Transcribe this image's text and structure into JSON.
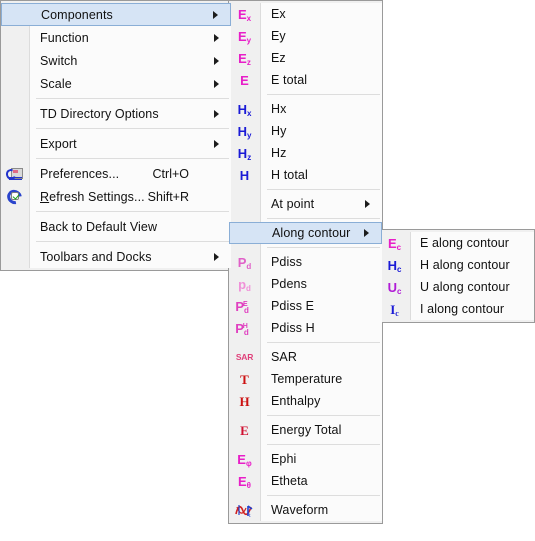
{
  "window": {
    "background": "#ffffff",
    "menu_bg": "#fbfbfb",
    "gutter_bg": "#f0f0f0",
    "border": "#9a9a9a",
    "highlight_bg": "#d6e4f5",
    "highlight_border": "#8aaed6",
    "separator": "#dddddd"
  },
  "menu1": {
    "name": "view-menu",
    "items": [
      {
        "type": "item",
        "label": "Components",
        "icon": "",
        "shortcut": "",
        "submenu": true,
        "selected": true
      },
      {
        "type": "item",
        "label": "Function",
        "icon": "",
        "shortcut": "",
        "submenu": true,
        "selected": false
      },
      {
        "type": "item",
        "label": "Switch",
        "icon": "",
        "shortcut": "",
        "submenu": true,
        "selected": false
      },
      {
        "type": "item",
        "label": "Scale",
        "icon": "",
        "shortcut": "",
        "submenu": true,
        "selected": false
      },
      {
        "type": "separator"
      },
      {
        "type": "item",
        "label": "TD Directory Options",
        "icon": "",
        "shortcut": "",
        "submenu": true,
        "selected": false
      },
      {
        "type": "separator"
      },
      {
        "type": "item",
        "label": "Export",
        "icon": "",
        "shortcut": "",
        "submenu": true,
        "selected": false
      },
      {
        "type": "separator"
      },
      {
        "type": "item",
        "label": "Preferences...",
        "icon": "preferences-icon",
        "shortcut": "Ctrl+O",
        "submenu": false,
        "selected": false
      },
      {
        "type": "item",
        "label": "Refresh Settings...",
        "icon": "refresh-icon",
        "shortcut": "Shift+R",
        "submenu": false,
        "selected": false,
        "mnemonic": "R"
      },
      {
        "type": "separator"
      },
      {
        "type": "item",
        "label": "Back to Default View",
        "icon": "",
        "shortcut": "",
        "submenu": false,
        "selected": false
      },
      {
        "type": "separator"
      },
      {
        "type": "item",
        "label": "Toolbars and Docks",
        "icon": "",
        "shortcut": "",
        "submenu": true,
        "selected": false
      }
    ]
  },
  "menu2": {
    "name": "components-submenu",
    "items": [
      {
        "type": "item",
        "label": "Ex",
        "icon": "ex-icon",
        "icon_text": "E",
        "icon_sub": "x",
        "icon_color": "#e81ec8",
        "submenu": false,
        "selected": false
      },
      {
        "type": "item",
        "label": "Ey",
        "icon": "ey-icon",
        "icon_text": "E",
        "icon_sub": "y",
        "icon_color": "#e81ec8",
        "submenu": false,
        "selected": false
      },
      {
        "type": "item",
        "label": "Ez",
        "icon": "ez-icon",
        "icon_text": "E",
        "icon_sub": "z",
        "icon_color": "#e81ec8",
        "submenu": false,
        "selected": false
      },
      {
        "type": "item",
        "label": "E total",
        "icon": "e-total-icon",
        "icon_text": "E",
        "icon_sub": "",
        "icon_color": "#e81ec8",
        "submenu": false,
        "selected": false
      },
      {
        "type": "separator"
      },
      {
        "type": "item",
        "label": "Hx",
        "icon": "hx-icon",
        "icon_text": "H",
        "icon_sub": "x",
        "icon_color": "#1a1ad6",
        "submenu": false,
        "selected": false
      },
      {
        "type": "item",
        "label": "Hy",
        "icon": "hy-icon",
        "icon_text": "H",
        "icon_sub": "y",
        "icon_color": "#1a1ad6",
        "submenu": false,
        "selected": false
      },
      {
        "type": "item",
        "label": "Hz",
        "icon": "hz-icon",
        "icon_text": "H",
        "icon_sub": "z",
        "icon_color": "#1a1ad6",
        "submenu": false,
        "selected": false
      },
      {
        "type": "item",
        "label": "H total",
        "icon": "h-total-icon",
        "icon_text": "H",
        "icon_sub": "",
        "icon_color": "#1a1ad6",
        "submenu": false,
        "selected": false
      },
      {
        "type": "separator"
      },
      {
        "type": "item",
        "label": "At point",
        "icon": "",
        "submenu": true,
        "selected": false
      },
      {
        "type": "separator"
      },
      {
        "type": "item",
        "label": "Along contour",
        "icon": "",
        "submenu": true,
        "selected": true
      },
      {
        "type": "separator"
      },
      {
        "type": "item",
        "label": "Pdiss",
        "icon": "pdiss-icon",
        "icon_text": "P",
        "icon_sub": "d",
        "icon_color": "#e060c8",
        "submenu": false,
        "selected": false
      },
      {
        "type": "item",
        "label": "Pdens",
        "icon": "pdens-icon",
        "icon_text": "p",
        "icon_sub": "d",
        "icon_color": "#f090d8",
        "submenu": false,
        "selected": false
      },
      {
        "type": "item",
        "label": "Pdiss E",
        "icon": "pdiss-e-icon",
        "icon_text": "P",
        "icon_sub": "d",
        "icon_sup": "E",
        "icon_color": "#e040c0",
        "submenu": false,
        "selected": false
      },
      {
        "type": "item",
        "label": "Pdiss H",
        "icon": "pdiss-h-icon",
        "icon_text": "P",
        "icon_sub": "d",
        "icon_sup": "H",
        "icon_color": "#e040c0",
        "submenu": false,
        "selected": false
      },
      {
        "type": "separator"
      },
      {
        "type": "item",
        "label": "SAR",
        "icon": "sar-icon",
        "icon_text": "SAR",
        "icon_color": "#e0407a",
        "submenu": false,
        "selected": false
      },
      {
        "type": "item",
        "label": "Temperature",
        "icon": "temperature-icon",
        "icon_text": "T",
        "icon_color": "#cc1111",
        "submenu": false,
        "selected": false
      },
      {
        "type": "item",
        "label": "Enthalpy",
        "icon": "enthalpy-icon",
        "icon_text": "H",
        "icon_color": "#cc1111",
        "submenu": false,
        "selected": false
      },
      {
        "type": "separator"
      },
      {
        "type": "item",
        "label": "Energy Total",
        "icon": "energy-total-icon",
        "icon_text": "E",
        "icon_color": "#d01030",
        "submenu": false,
        "selected": false
      },
      {
        "type": "separator"
      },
      {
        "type": "item",
        "label": "Ephi",
        "icon": "ephi-icon",
        "icon_text": "E",
        "icon_sub": "φ",
        "icon_color": "#e81ec8",
        "submenu": false,
        "selected": false
      },
      {
        "type": "item",
        "label": "Etheta",
        "icon": "etheta-icon",
        "icon_text": "E",
        "icon_sub": "θ",
        "icon_color": "#e81ec8",
        "submenu": false,
        "selected": false
      },
      {
        "type": "separator"
      },
      {
        "type": "item",
        "label": "Waveform",
        "icon": "waveform-icon",
        "submenu": false,
        "selected": false
      }
    ]
  },
  "menu3": {
    "name": "along-contour-submenu",
    "items": [
      {
        "type": "item",
        "label": "E along contour",
        "icon": "e-contour-icon",
        "icon_text": "E",
        "icon_sub": "c",
        "icon_color": "#e81ec8",
        "selected": false
      },
      {
        "type": "item",
        "label": "H along contour",
        "icon": "h-contour-icon",
        "icon_text": "H",
        "icon_sub": "c",
        "icon_color": "#1a1ad6",
        "selected": false
      },
      {
        "type": "item",
        "label": "U along contour",
        "icon": "u-contour-icon",
        "icon_text": "U",
        "icon_sub": "c",
        "icon_color": "#b01ad6",
        "selected": false
      },
      {
        "type": "item",
        "label": "I along contour",
        "icon": "i-contour-icon",
        "icon_text": "I",
        "icon_sub": "c",
        "icon_color": "#1a1ad6",
        "selected": false
      }
    ]
  }
}
